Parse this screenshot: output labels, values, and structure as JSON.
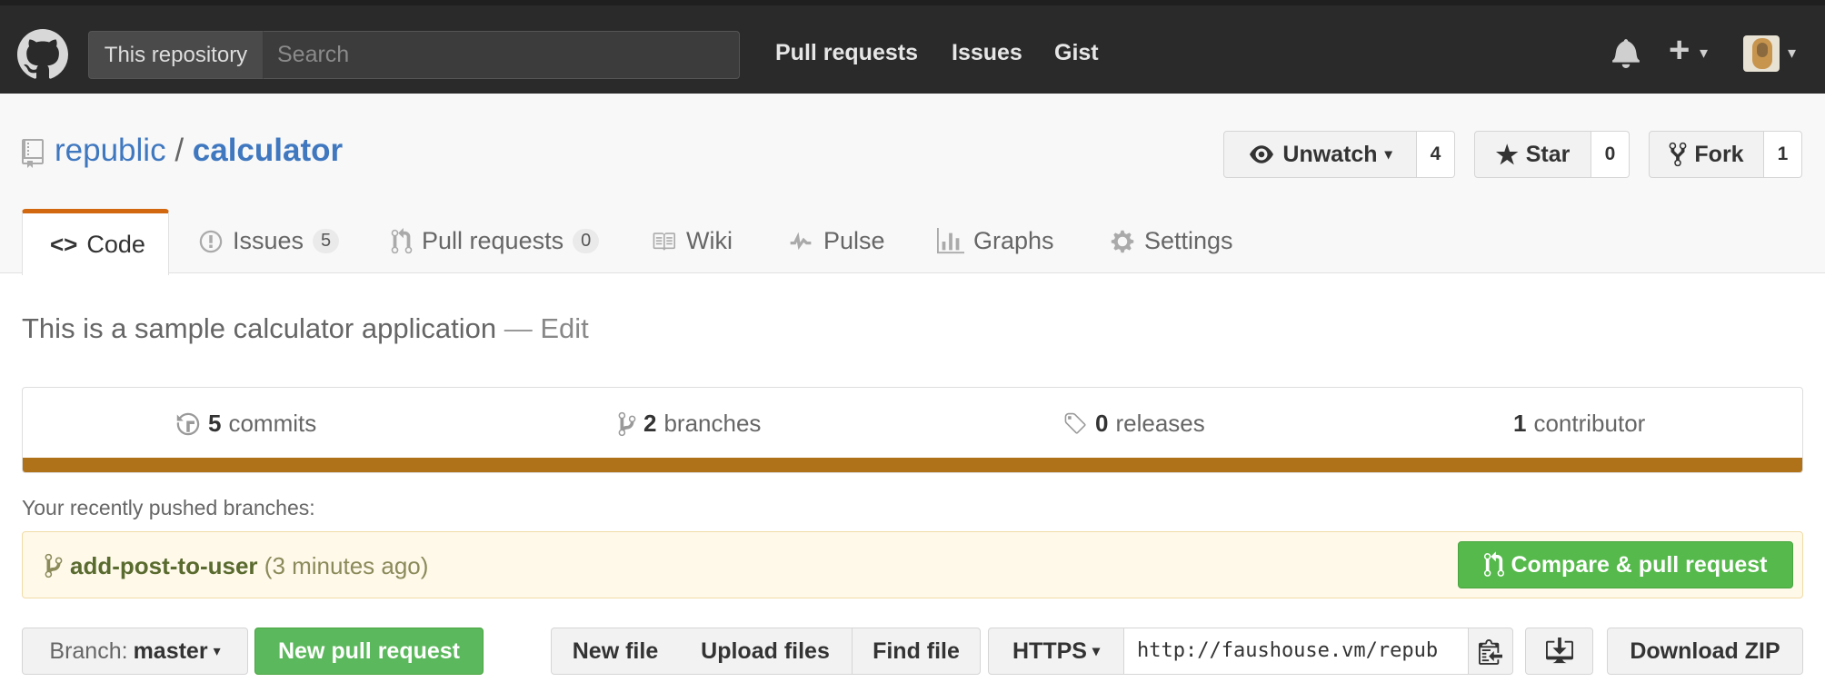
{
  "header": {
    "scope_label": "This repository",
    "search_placeholder": "Search",
    "nav": [
      "Pull requests",
      "Issues",
      "Gist"
    ],
    "plus_symbol": "+"
  },
  "repo": {
    "owner": "republic",
    "separator": "/",
    "name": "calculator"
  },
  "actions": {
    "watch_label": "Unwatch",
    "watch_count": "4",
    "star_label": "Star",
    "star_count": "0",
    "fork_label": "Fork",
    "fork_count": "1"
  },
  "tabs": [
    {
      "label": "Code",
      "icon": "code-icon"
    },
    {
      "label": "Issues",
      "count": "5",
      "icon": "issue-icon"
    },
    {
      "label": "Pull requests",
      "count": "0",
      "icon": "pull-request-icon"
    },
    {
      "label": "Wiki",
      "icon": "book-icon"
    },
    {
      "label": "Pulse",
      "icon": "pulse-icon"
    },
    {
      "label": "Graphs",
      "icon": "graph-icon"
    },
    {
      "label": "Settings",
      "icon": "gear-icon"
    }
  ],
  "description": {
    "text": "This is a sample calculator application",
    "dash": "—",
    "edit": "Edit"
  },
  "stats": {
    "commits_count": "5",
    "commits_label": "commits",
    "branches_count": "2",
    "branches_label": "branches",
    "releases_count": "0",
    "releases_label": "releases",
    "contributors_count": "1",
    "contributors_label": "contributor",
    "language_color": "#b07219"
  },
  "recent": {
    "label": "Your recently pushed branches:",
    "branch": "add-post-to-user",
    "time": "(3 minutes ago)",
    "compare_label": "Compare & pull request"
  },
  "toolbar": {
    "branch_prefix": "Branch:",
    "branch_name": "master",
    "new_pr": "New pull request",
    "new_file": "New file",
    "upload": "Upload files",
    "find": "Find file",
    "protocol": "HTTPS",
    "clone_url": "http://faushouse.vm/repub",
    "download": "Download ZIP"
  }
}
